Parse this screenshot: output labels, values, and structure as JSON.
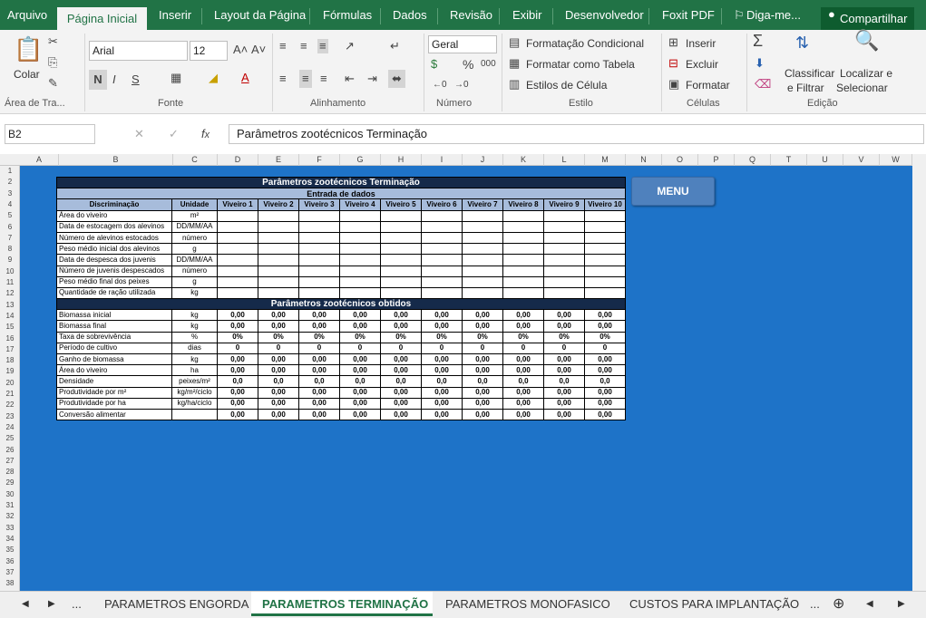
{
  "tabs": {
    "file": "Arquivo",
    "home": "Página Inicial",
    "insert": "Inserir",
    "layout": "Layout da Página",
    "formulas": "Fórmulas",
    "data": "Dados",
    "review": "Revisão",
    "view": "Exibir",
    "developer": "Desenvolvedor",
    "foxit": "Foxit PDF",
    "tellme": "Diga-me...",
    "share": "Compartilhar"
  },
  "ribbon": {
    "paste": "Colar",
    "clipboard": "Área de Tra...",
    "font_name": "Arial",
    "font_size": "12",
    "bold": "N",
    "italic": "I",
    "underline": "S",
    "font_group": "Fonte",
    "align_group": "Alinhamento",
    "number_format": "Geral",
    "number_group": "Número",
    "cond_format": "Formatação Condicional",
    "format_table": "Formatar como Tabela",
    "cell_styles": "Estilos de Célula",
    "style_group": "Estilo",
    "insert": "Inserir",
    "delete": "Excluir",
    "format": "Formatar",
    "cells_group": "Células",
    "sort_filter_1": "Classificar",
    "sort_filter_2": "e Filtrar",
    "find_1": "Localizar e",
    "find_2": "Selecionar",
    "edit_group": "Edição"
  },
  "formula": {
    "namebox": "B2",
    "content": "Parâmetros zootécnicos Terminação"
  },
  "columns": [
    "A",
    "B",
    "C",
    "D",
    "E",
    "F",
    "G",
    "H",
    "I",
    "J",
    "K",
    "L",
    "M",
    "N",
    "O",
    "P",
    "Q",
    "T",
    "U",
    "V",
    "W"
  ],
  "rows": [
    "1",
    "2",
    "3",
    "4",
    "5",
    "6",
    "7",
    "8",
    "9",
    "10",
    "11",
    "12",
    "13",
    "14",
    "15",
    "16",
    "17",
    "18",
    "19",
    "20",
    "21",
    "22",
    "23",
    "24",
    "25",
    "26",
    "27",
    "28",
    "29",
    "30",
    "31",
    "32",
    "33",
    "34",
    "35",
    "36",
    "37",
    "38"
  ],
  "sheet": {
    "title": "Parâmetros zootécnicos Terminação",
    "input_section": "Entrada de dados",
    "col_disc": "Discriminação",
    "col_unit": "Unidade",
    "ponds": [
      "Viveiro 1",
      "Viveiro 2",
      "Viveiro 3",
      "Viveiro 4",
      "Viveiro 5",
      "Viveiro 6",
      "Viveiro 7",
      "Viveiro 8",
      "Viveiro 9",
      "Viveiro 10"
    ],
    "inputs": [
      {
        "label": "Área do viveiro",
        "unit": "m²"
      },
      {
        "label": "Data de estocagem dos alevinos",
        "unit": "DD/MM/AA"
      },
      {
        "label": "Número de alevinos estocados",
        "unit": "número"
      },
      {
        "label": "Peso médio inicial dos alevinos",
        "unit": "g"
      },
      {
        "label": "Data de despesca dos juvenis",
        "unit": "DD/MM/AA"
      },
      {
        "label": "Número de juvenis despescados",
        "unit": "número"
      },
      {
        "label": "Peso médio final dos peixes",
        "unit": "g"
      },
      {
        "label": "Quantidade de ração utilizada",
        "unit": "kg"
      }
    ],
    "output_section": "Parâmetros zootécnicos obtidos",
    "outputs": [
      {
        "label": "Biomassa inicial",
        "unit": "kg",
        "value": "0,00"
      },
      {
        "label": "Biomassa final",
        "unit": "kg",
        "value": "0,00"
      },
      {
        "label": "Taxa de sobrevivência",
        "unit": "%",
        "value": "0%"
      },
      {
        "label": "Período de cultivo",
        "unit": "dias",
        "value": "0"
      },
      {
        "label": "Ganho de biomassa",
        "unit": "kg",
        "value": "0,00"
      },
      {
        "label": "Área do viveiro",
        "unit": "ha",
        "value": "0,00"
      },
      {
        "label": "Densidade",
        "unit": "peixes/m²",
        "value": "0,0"
      },
      {
        "label": "Produtividade por m²",
        "unit": "kg/m²/ciclo",
        "value": "0,00"
      },
      {
        "label": "Produtividade por ha",
        "unit": "kg/ha/ciclo",
        "value": "0,00"
      },
      {
        "label": "Conversão alimentar",
        "unit": "",
        "value": "0,00"
      }
    ]
  },
  "menu_button": "MENU",
  "sheet_tabs": {
    "more_left": "...",
    "tab1": "PARAMETROS ENGORDA",
    "tab2": "PARAMETROS TERMINAÇÃO",
    "tab3": "PARAMETROS MONOFASICO",
    "tab4": "CUSTOS PARA IMPLANTAÇÃO",
    "more_right": "..."
  }
}
